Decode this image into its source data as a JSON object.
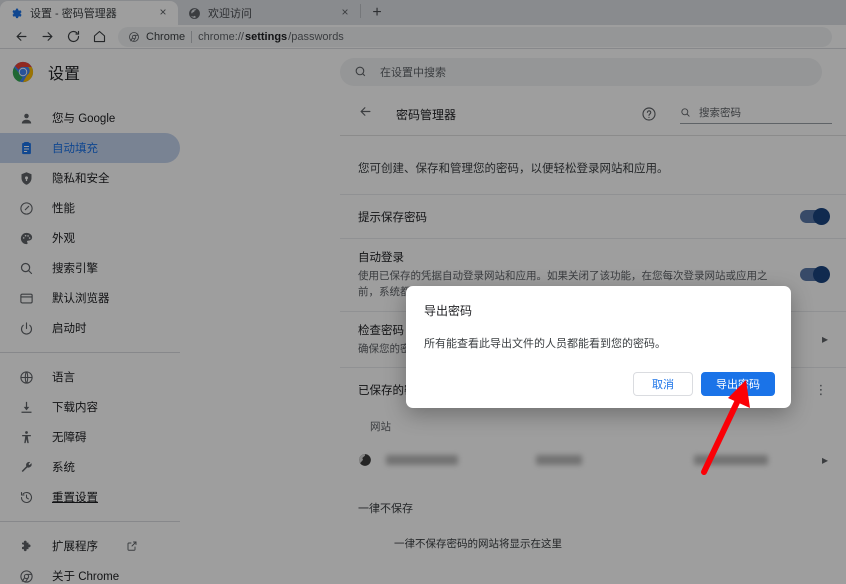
{
  "browser": {
    "tabs": [
      {
        "title": "设置 - 密码管理器",
        "favicon": "gear-icon",
        "active": true,
        "close_label": "×"
      },
      {
        "title": "欢迎访问",
        "favicon": "globe-icon",
        "active": false,
        "close_label": "×"
      }
    ],
    "new_tab_label": "+",
    "nav": {
      "back": "←",
      "forward": "→",
      "reload": "C",
      "home": "⌂"
    },
    "omnibox": {
      "chip_label": "Chrome",
      "url_scheme": "chrome://",
      "url_host_bold": "settings",
      "url_path": "/passwords"
    }
  },
  "settings": {
    "brand_title": "设置",
    "search_placeholder": "在设置中搜索",
    "sidebar": {
      "items": [
        {
          "label": "您与 Google",
          "icon": "person-icon",
          "selected": false
        },
        {
          "label": "自动填充",
          "icon": "autofill-icon",
          "selected": true
        },
        {
          "label": "隐私和安全",
          "icon": "shield-icon",
          "selected": false
        },
        {
          "label": "性能",
          "icon": "performance-icon",
          "selected": false
        },
        {
          "label": "外观",
          "icon": "palette-icon",
          "selected": false
        },
        {
          "label": "搜索引擎",
          "icon": "search-icon",
          "selected": false
        },
        {
          "label": "默认浏览器",
          "icon": "browser-icon",
          "selected": false
        },
        {
          "label": "启动时",
          "icon": "power-icon",
          "selected": false
        }
      ],
      "items2": [
        {
          "label": "语言",
          "icon": "globe-icon",
          "selected": false
        },
        {
          "label": "下载内容",
          "icon": "download-icon",
          "selected": false
        },
        {
          "label": "无障碍",
          "icon": "accessibility-icon",
          "selected": false
        },
        {
          "label": "系统",
          "icon": "wrench-icon",
          "selected": false
        },
        {
          "label": "重置设置",
          "icon": "history-icon",
          "selected": false,
          "underline": true
        }
      ],
      "items3": [
        {
          "label": "扩展程序",
          "icon": "puzzle-icon",
          "external": true
        },
        {
          "label": "关于 Chrome",
          "icon": "chrome-icon",
          "external": false
        }
      ]
    }
  },
  "password_manager": {
    "back_label": "←",
    "title": "密码管理器",
    "help_label": "?",
    "search_placeholder": "搜索密码",
    "intro": "您可创建、保存和管理您的密码，以便轻松登录网站和应用。",
    "rows": [
      {
        "title": "提示保存密码",
        "sub": "",
        "control": "toggle",
        "toggle_on": true
      },
      {
        "title": "自动登录",
        "sub": "使用已保存的凭据自动登录网站和应用。如果关闭了该功能，在您每次登录网站或应用之前，系统都会要求您确认。",
        "control": "toggle",
        "toggle_on": true
      },
      {
        "title": "检查密码",
        "sub": "确保您的密码安全无虞",
        "control": "chevron",
        "chevron_label": "▸"
      }
    ],
    "saved_section": {
      "title": "已保存的密码",
      "menu_label": "⋮",
      "column_header": "网站",
      "entries": [
        {
          "favicon": "globe-icon",
          "site_redacted": true,
          "user_redacted": true,
          "password_redacted": true,
          "chevron_label": "▸"
        }
      ]
    },
    "never_saved": {
      "title": "一律不保存",
      "empty_text": "一律不保存密码的网站将显示在这里"
    }
  },
  "dialog": {
    "title": "导出密码",
    "message": "所有能查看此导出文件的人员都能看到您的密码。",
    "cancel_label": "取消",
    "confirm_label": "导出密码"
  },
  "colors": {
    "accent": "#1a73e8",
    "annotation": "#fb0007",
    "selected_nav_bg": "#c4d3ee",
    "chrome_tabstrip": "#dee1e6"
  }
}
